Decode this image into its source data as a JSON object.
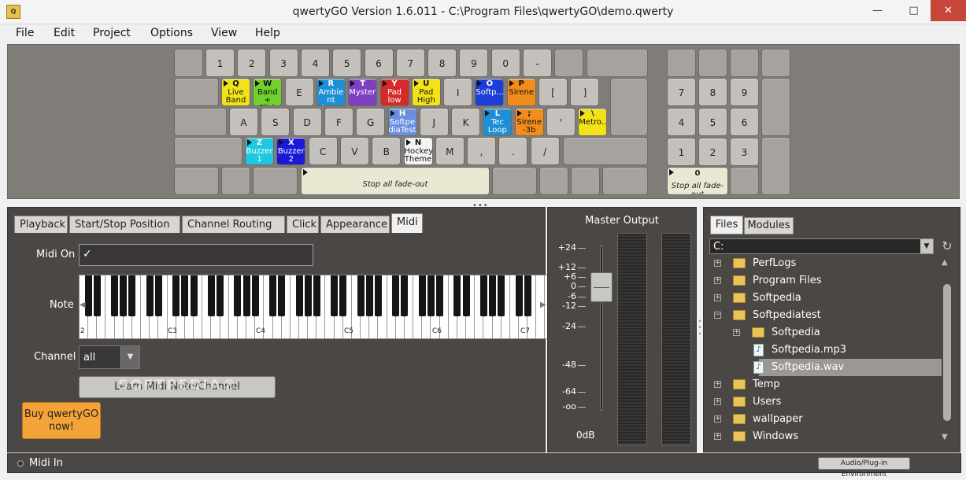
{
  "window": {
    "title": "qwertyGO Version 1.6.011 - C:\\Program Files\\qwertyGO\\demo.qwerty",
    "icon": "app-icon",
    "min_icon": "—",
    "max_icon": "□",
    "close_icon": "✕"
  },
  "menu": [
    "File",
    "Edit",
    "Project",
    "Options",
    "View",
    "Help"
  ],
  "keyboard": {
    "digits": [
      "1",
      "2",
      "3",
      "4",
      "5",
      "6",
      "7",
      "8",
      "9",
      "0",
      "-"
    ],
    "row_q": [
      {
        "key": "Q",
        "name": "Live Band",
        "color": "#f3e21a"
      },
      {
        "key": "W",
        "name": "Band + Click",
        "color": "#6fd12a"
      },
      {
        "key": "E",
        "name": ""
      },
      {
        "key": "R",
        "name": "Ambie nt Loop",
        "color": "#1d8fd6"
      },
      {
        "key": "T",
        "name": "Mystery",
        "color": "#7d3fc0"
      },
      {
        "key": "Y",
        "name": "Pad low",
        "color": "#d52a2a"
      },
      {
        "key": "U",
        "name": "Pad High",
        "color": "#f3e21a"
      },
      {
        "key": "I",
        "name": ""
      },
      {
        "key": "O",
        "name": "Softp...",
        "color": "#1a3ed6"
      },
      {
        "key": "P",
        "name": "Sirene",
        "color": "#f28c1c"
      },
      {
        "key": "[",
        "name": ""
      },
      {
        "key": "]",
        "name": ""
      }
    ],
    "row_a": [
      {
        "key": "A",
        "name": ""
      },
      {
        "key": "S",
        "name": ""
      },
      {
        "key": "D",
        "name": ""
      },
      {
        "key": "F",
        "name": ""
      },
      {
        "key": "G",
        "name": ""
      },
      {
        "key": "H",
        "name": "Softpe diaTest",
        "color": "#6a8ee0"
      },
      {
        "key": "J",
        "name": ""
      },
      {
        "key": "K",
        "name": ""
      },
      {
        "key": "L",
        "name": "Tec Loop ...",
        "color": "#1d8fd6"
      },
      {
        "key": ";",
        "name": "Sirene -3b",
        "color": "#f28c1c"
      },
      {
        "key": "'",
        "name": ""
      },
      {
        "key": "\\",
        "name": "Metro...",
        "color": "#f3e21a"
      }
    ],
    "row_z": [
      {
        "key": "Z",
        "name": "Buzzer 1",
        "color": "#1ec8e0"
      },
      {
        "key": "X",
        "name": "Buzzer 2",
        "color": "#1a1ad6"
      },
      {
        "key": "C",
        "name": ""
      },
      {
        "key": "V",
        "name": ""
      },
      {
        "key": "B",
        "name": ""
      },
      {
        "key": "N",
        "name": "Hockey Theme",
        "color": "#f4f4f4"
      },
      {
        "key": "M",
        "name": ""
      },
      {
        "key": ",",
        "name": ""
      },
      {
        "key": ".",
        "name": ""
      },
      {
        "key": "/",
        "name": ""
      }
    ],
    "space": "Stop all fade-out",
    "numpad": [
      "7",
      "8",
      "9",
      "4",
      "5",
      "6",
      "1",
      "2",
      "3"
    ],
    "numpad_zero": {
      "key": "0",
      "name": "Stop all fade-out"
    },
    "grip": "•••"
  },
  "tabs": [
    "Playback",
    "Start/Stop Position",
    "Channel Routing",
    "Click",
    "Appearance",
    "Midi"
  ],
  "active_tab": "Midi",
  "midi": {
    "midi_on_label": "Midi On",
    "midi_on_check": "✓",
    "note_label": "Note",
    "octaves": [
      "C3",
      "C4",
      "C5",
      "C6",
      "C7"
    ],
    "octave_cut": "2",
    "scroll_left": "◀",
    "scroll_right": "▶",
    "channel_label": "Channel",
    "channel_value": "all",
    "channel_arrow": "▼",
    "learn_button": "Learn Midi Note/Channel"
  },
  "watermark": "SOFTPEDIA®",
  "buy_button": "Buy qwertyGO now!",
  "status": {
    "midi_in": "Midi In",
    "audio_button": "Audio/Plug-in Environment"
  },
  "master": {
    "title": "Master Output",
    "db_labels": [
      "+24",
      "+12",
      "+6",
      "0",
      "-6",
      "-12",
      "-24",
      "-48",
      "-64",
      "-oo"
    ],
    "readout": "0dB"
  },
  "files": {
    "files_tab": "Files",
    "modules_tab": "Modules",
    "drive": "C:",
    "drive_arrow": "▼",
    "refresh_icon": "↻",
    "tree": [
      {
        "label": "PerfLogs",
        "type": "folder",
        "level": 0,
        "expander": "+"
      },
      {
        "label": "Program Files",
        "type": "folder",
        "level": 0,
        "expander": "+"
      },
      {
        "label": "Softpedia",
        "type": "folder",
        "level": 0,
        "expander": "+"
      },
      {
        "label": "Softpediatest",
        "type": "folder",
        "level": 0,
        "expander": "−"
      },
      {
        "label": "Softpedia",
        "type": "folder",
        "level": 1,
        "expander": "+"
      },
      {
        "label": "Softpedia.mp3",
        "type": "file",
        "level": 1,
        "expander": ""
      },
      {
        "label": "Softpedia.wav",
        "type": "file",
        "level": 1,
        "expander": "",
        "selected": true
      },
      {
        "label": "Temp",
        "type": "folder",
        "level": 0,
        "expander": "+"
      },
      {
        "label": "Users",
        "type": "folder",
        "level": 0,
        "expander": "+"
      },
      {
        "label": "wallpaper",
        "type": "folder",
        "level": 0,
        "expander": "+"
      },
      {
        "label": "Windows",
        "type": "folder",
        "level": 0,
        "expander": "+"
      }
    ],
    "file_glyph": "♪",
    "scroll_up": "▲",
    "scroll_down": "▼"
  }
}
